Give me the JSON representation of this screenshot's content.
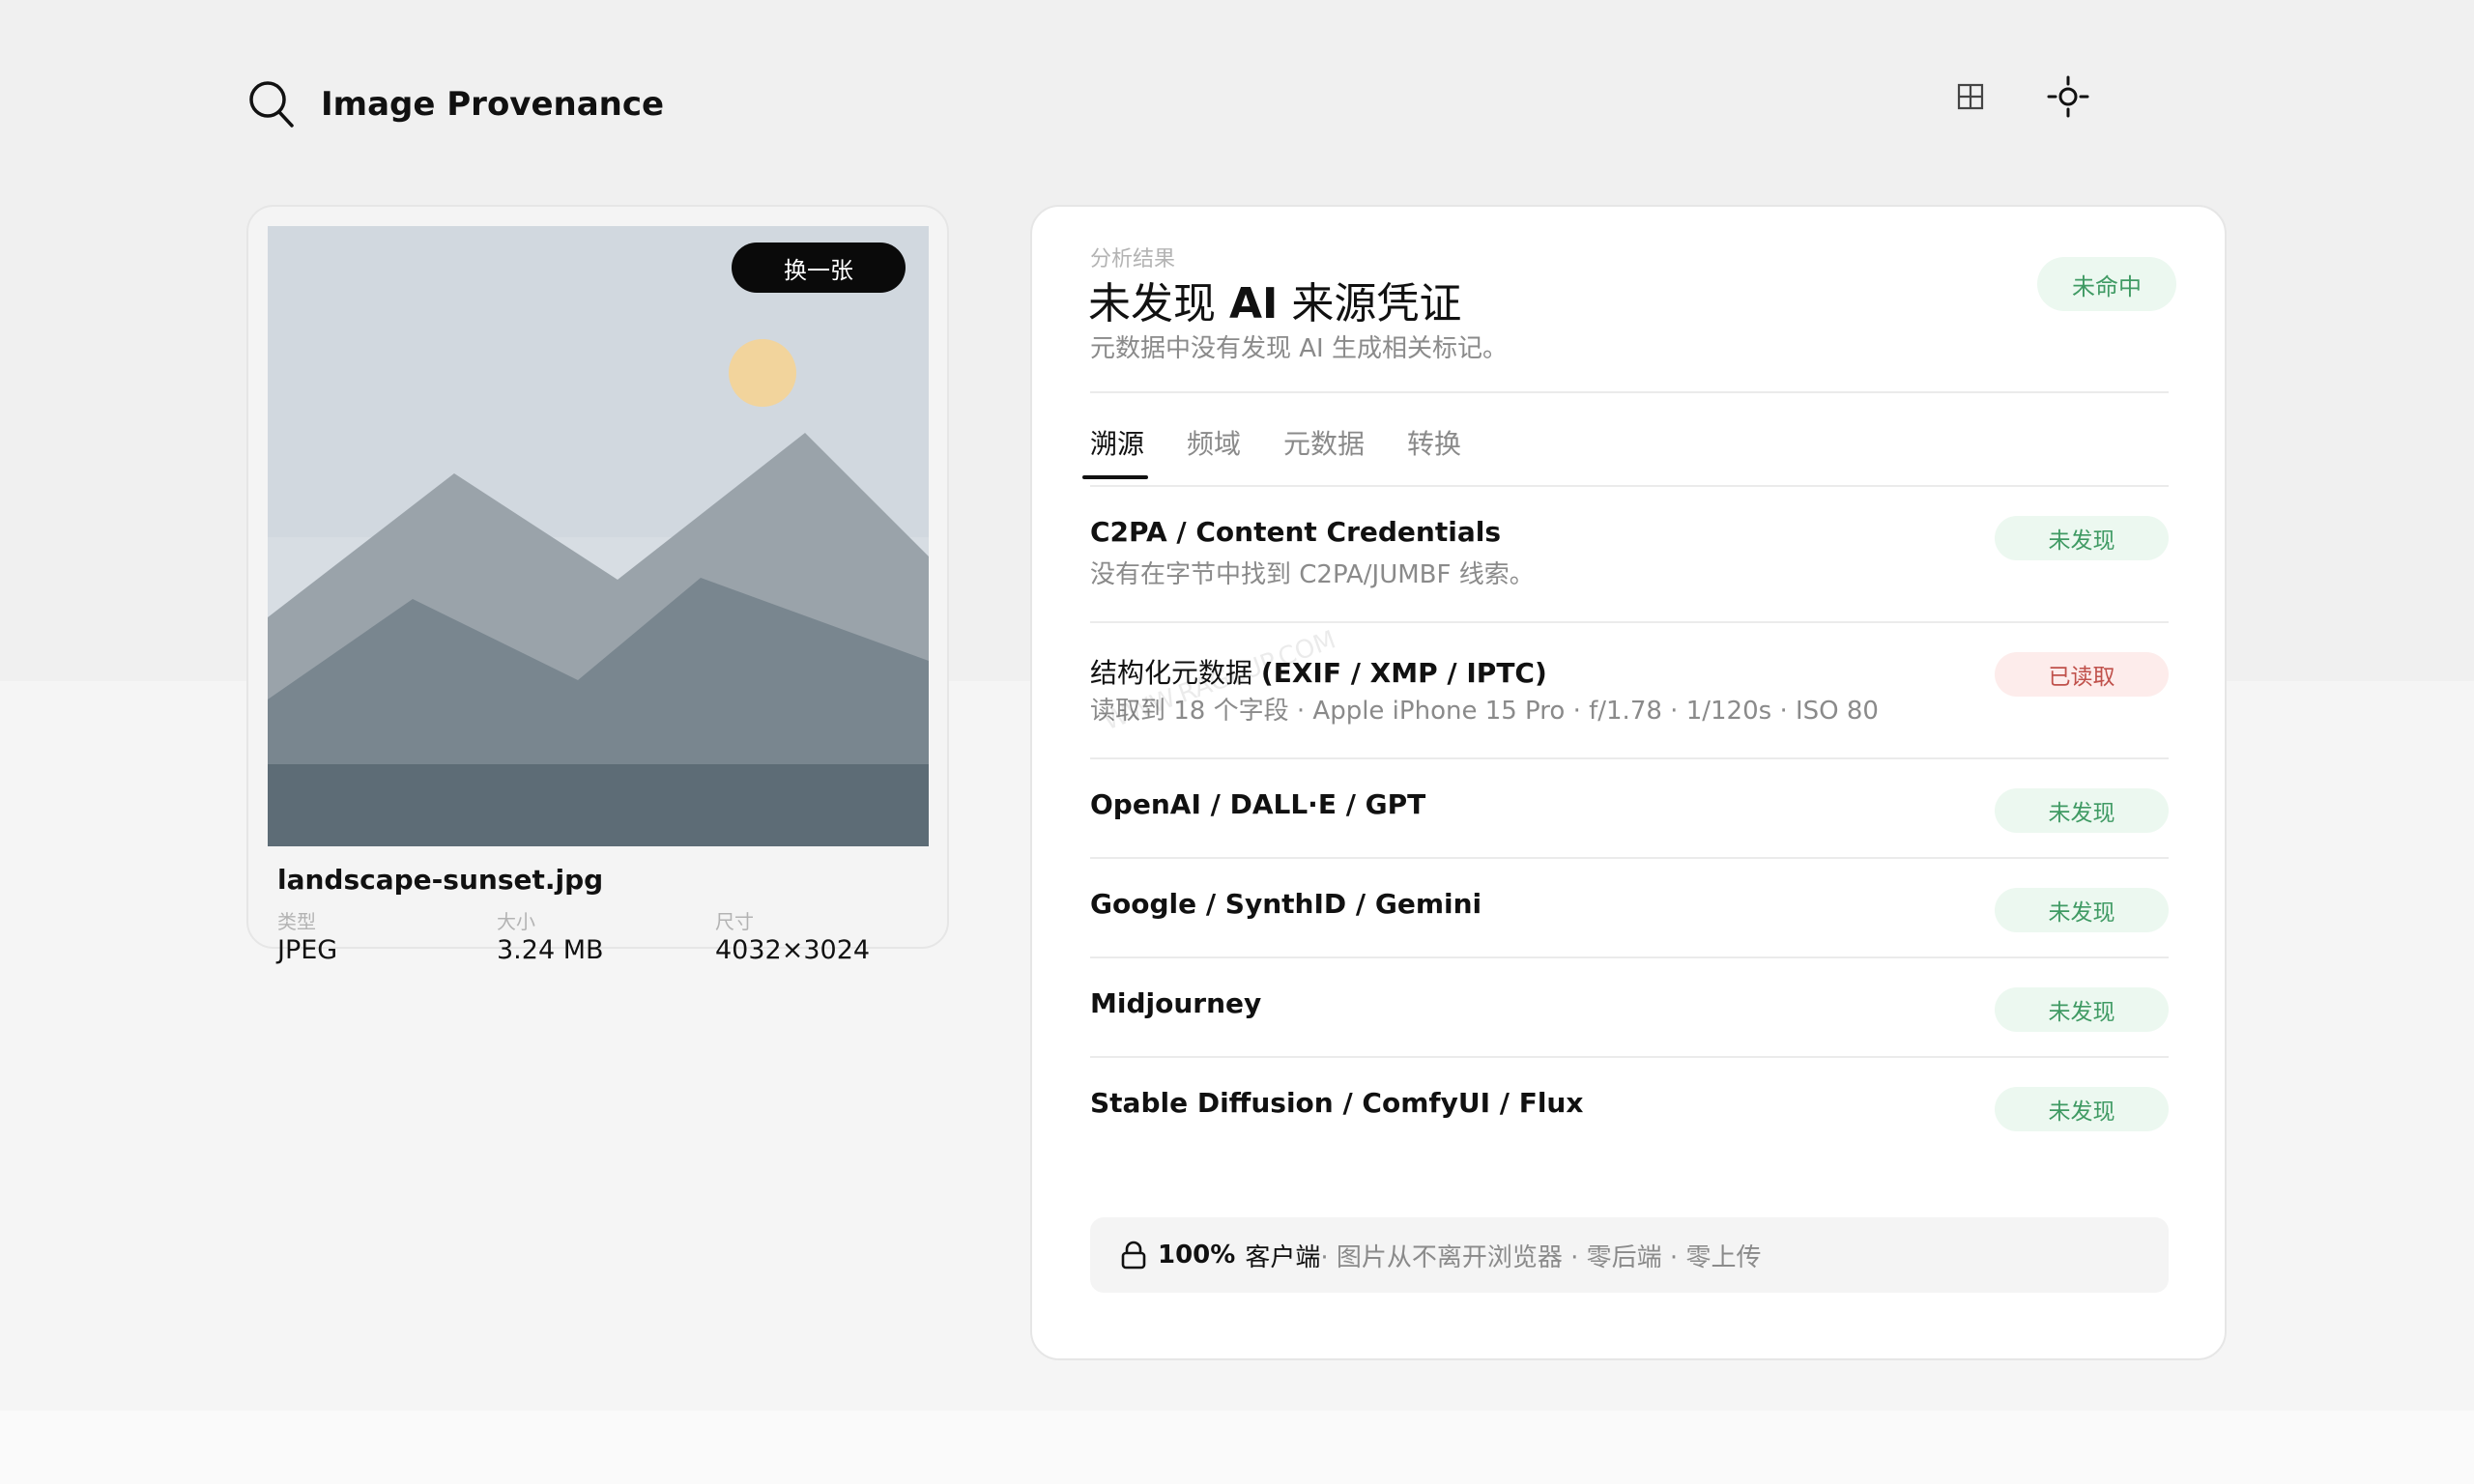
{
  "header": {
    "title": "Image Provenance"
  },
  "image": {
    "swap_label": "换一张",
    "file_name": "landscape-sunset.jpg",
    "meta": [
      {
        "label": "类型",
        "value": "JPEG"
      },
      {
        "label": "大小",
        "value": "3.24 MB"
      },
      {
        "label": "尺寸",
        "value": "4032×3024"
      }
    ]
  },
  "result": {
    "eyebrow": "分析结果",
    "headline_pre": "未发现 ",
    "headline_ai": "AI",
    "headline_post": " 来源凭证",
    "subline": "元数据中没有发现 AI 生成相关标记。",
    "status": "未命中",
    "tabs": [
      "溯源",
      "频域",
      "元数据",
      "转换"
    ],
    "rows": [
      {
        "title": "C2PA / Content Credentials",
        "desc": "没有在字节中找到 C2PA/JUMBF 线索。",
        "badge": "未发现"
      },
      {
        "title_cn": "结构化元数据 ",
        "title": "(EXIF / XMP / IPTC)",
        "desc": "读取到 18 个字段 · Apple iPhone 15 Pro · f/1.78 · 1/120s · ISO 80",
        "badge": "已读取"
      },
      {
        "title": "OpenAI / DALL·E / GPT",
        "badge": "未发现"
      },
      {
        "title": "Google / SynthID / Gemini",
        "badge": "未发现"
      },
      {
        "title": "Midjourney",
        "badge": "未发现"
      },
      {
        "title": "Stable Diffusion / ComfyUI / Flux",
        "badge": "未发现"
      }
    ],
    "footer": {
      "strong": "100%",
      "who": "客户端",
      "rest": "· 图片从不离开浏览器 · 零后端 · 零上传"
    },
    "watermark": "WWW.RAGEUP.COM"
  },
  "colors": {
    "badge_ok_bg": "#ecf8f0",
    "badge_ok_text": "#3f9a63",
    "badge_read_bg": "#fdeceb",
    "badge_read_text": "#c0514b"
  },
  "icons": [
    "search-icon",
    "grid-icon",
    "sun-icon",
    "lock-icon"
  ]
}
